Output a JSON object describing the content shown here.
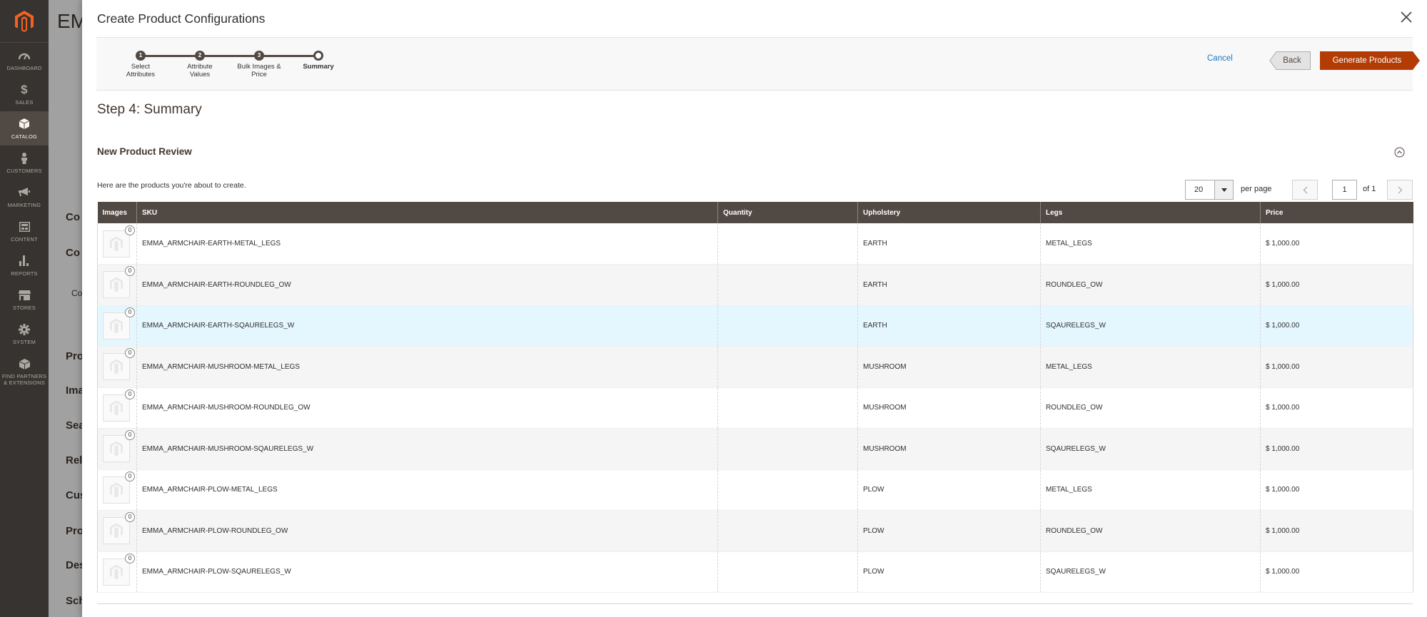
{
  "sidebar": {
    "items": [
      {
        "label": "DASHBOARD",
        "icon": "dashboard-icon"
      },
      {
        "label": "SALES",
        "icon": "dollar-icon"
      },
      {
        "label": "CATALOG",
        "icon": "cube-icon",
        "active": true
      },
      {
        "label": "CUSTOMERS",
        "icon": "person-icon"
      },
      {
        "label": "MARKETING",
        "icon": "megaphone-icon"
      },
      {
        "label": "CONTENT",
        "icon": "layout-icon"
      },
      {
        "label": "REPORTS",
        "icon": "bar-chart-icon"
      },
      {
        "label": "STORES",
        "icon": "storefront-icon"
      },
      {
        "label": "SYSTEM",
        "icon": "gear-icon"
      },
      {
        "label": "FIND PARTNERS & EXTENSIONS",
        "icon": "extensions-icon"
      }
    ]
  },
  "background_page": {
    "title": "EM",
    "labels": [
      "Co",
      "Co",
      "Co",
      "Pro",
      "Ima",
      "Sea",
      "Rel",
      "Cus",
      "Pro",
      "Des",
      "Sch"
    ]
  },
  "modal": {
    "title": "Create Product Configurations",
    "wizard": {
      "steps": [
        {
          "number": "1",
          "label_line1": "Select",
          "label_line2": "Attributes"
        },
        {
          "number": "2",
          "label_line1": "Attribute",
          "label_line2": "Values"
        },
        {
          "number": "3",
          "label_line1": "Bulk Images &",
          "label_line2": "Price"
        },
        {
          "number": "",
          "label_line1": "Summary",
          "label_line2": ""
        }
      ],
      "cancel_label": "Cancel",
      "back_label": "Back",
      "generate_label": "Generate Products"
    },
    "step_title": "Step 4: Summary",
    "section_title": "New Product Review",
    "intro_text": "Here are the products you're about to create.",
    "pager": {
      "per_page_value": "20",
      "per_page_label": "per page",
      "current_page": "1",
      "of_label": "of 1"
    },
    "grid": {
      "columns": [
        "Images",
        "SKU",
        "Quantity",
        "Upholstery",
        "Legs",
        "Price"
      ],
      "rows": [
        {
          "images": "0",
          "sku": "EMMA_ARMCHAIR-EARTH-METAL_LEGS",
          "quantity": "",
          "upholstery": "EARTH",
          "legs": "METAL_LEGS",
          "price": "$ 1,000.00"
        },
        {
          "images": "0",
          "sku": "EMMA_ARMCHAIR-EARTH-ROUNDLEG_OW",
          "quantity": "",
          "upholstery": "EARTH",
          "legs": "ROUNDLEG_OW",
          "price": "$ 1,000.00"
        },
        {
          "images": "0",
          "sku": "EMMA_ARMCHAIR-EARTH-SQAURELEGS_W",
          "quantity": "",
          "upholstery": "EARTH",
          "legs": "SQAURELEGS_W",
          "price": "$ 1,000.00"
        },
        {
          "images": "0",
          "sku": "EMMA_ARMCHAIR-MUSHROOM-METAL_LEGS",
          "quantity": "",
          "upholstery": "MUSHROOM",
          "legs": "METAL_LEGS",
          "price": "$ 1,000.00"
        },
        {
          "images": "0",
          "sku": "EMMA_ARMCHAIR-MUSHROOM-ROUNDLEG_OW",
          "quantity": "",
          "upholstery": "MUSHROOM",
          "legs": "ROUNDLEG_OW",
          "price": "$ 1,000.00"
        },
        {
          "images": "0",
          "sku": "EMMA_ARMCHAIR-MUSHROOM-SQAURELEGS_W",
          "quantity": "",
          "upholstery": "MUSHROOM",
          "legs": "SQAURELEGS_W",
          "price": "$ 1,000.00"
        },
        {
          "images": "0",
          "sku": "EMMA_ARMCHAIR-PLOW-METAL_LEGS",
          "quantity": "",
          "upholstery": "PLOW",
          "legs": "METAL_LEGS",
          "price": "$ 1,000.00"
        },
        {
          "images": "0",
          "sku": "EMMA_ARMCHAIR-PLOW-ROUNDLEG_OW",
          "quantity": "",
          "upholstery": "PLOW",
          "legs": "ROUNDLEG_OW",
          "price": "$ 1,000.00"
        },
        {
          "images": "0",
          "sku": "EMMA_ARMCHAIR-PLOW-SQAURELEGS_W",
          "quantity": "",
          "upholstery": "PLOW",
          "legs": "SQAURELEGS_W",
          "price": "$ 1,000.00"
        }
      ]
    }
  },
  "colors": {
    "sidebar_bg": "#373330",
    "grid_header_bg": "#514943",
    "primary_button": "#b33c05",
    "link": "#1979c3",
    "row_highlight": "#e5f7fe"
  }
}
